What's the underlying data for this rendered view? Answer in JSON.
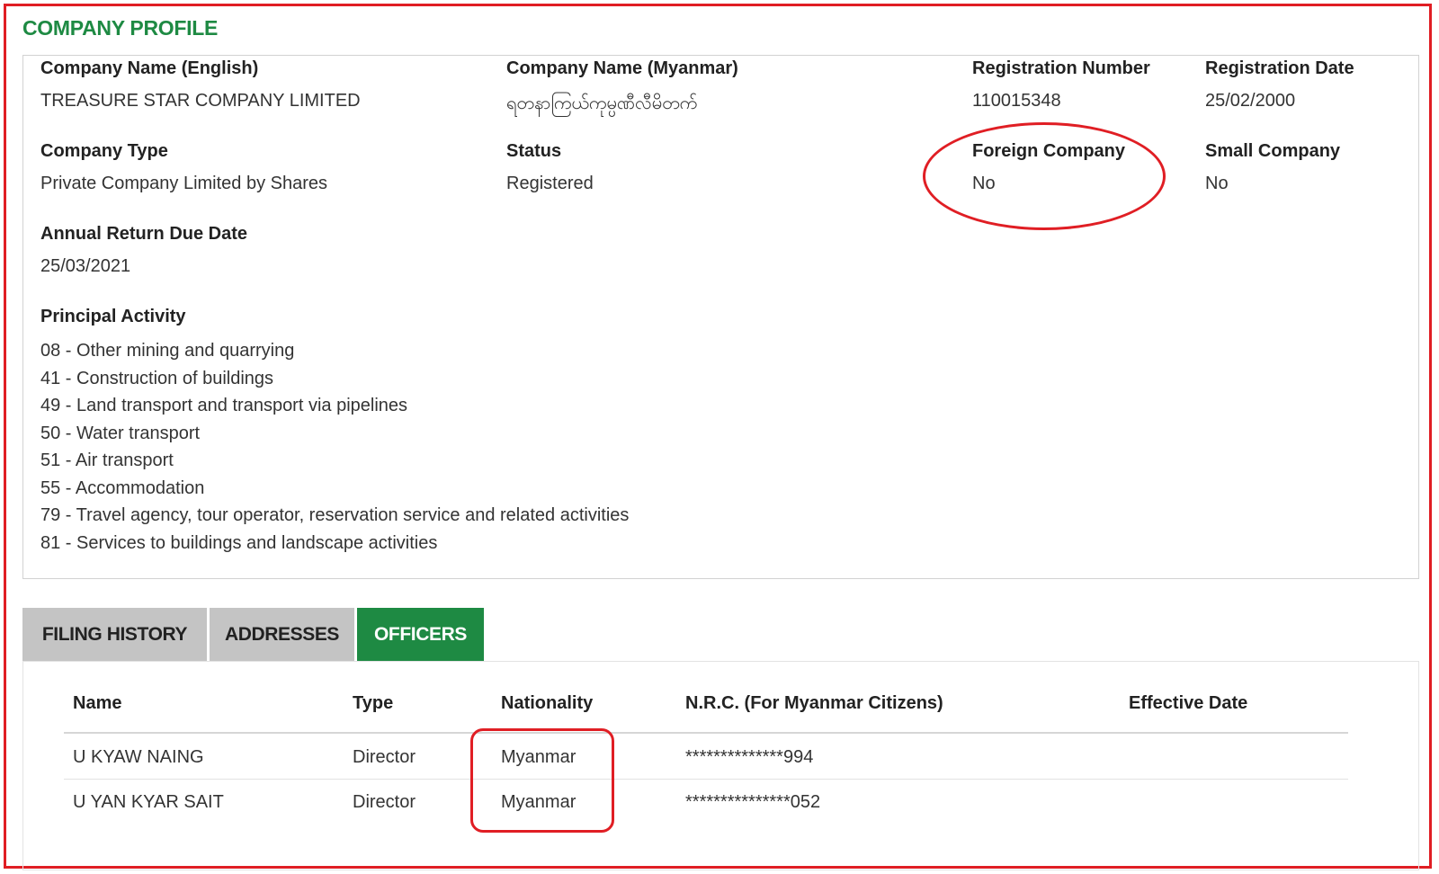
{
  "page": {
    "title": "COMPANY PROFILE",
    "accent_color": "#1e8a43",
    "annotation_color": "#e01e24"
  },
  "profile": {
    "company_name_en": {
      "label": "Company Name (English)",
      "value": "TREASURE STAR COMPANY LIMITED"
    },
    "company_name_mm": {
      "label": "Company Name (Myanmar)",
      "value": "ရတနာကြယ်ကုမ္ပဏီလီမိတက်"
    },
    "registration_number": {
      "label": "Registration Number",
      "value": "110015348"
    },
    "registration_date": {
      "label": "Registration Date",
      "value": "25/02/2000"
    },
    "company_type": {
      "label": "Company Type",
      "value": "Private Company Limited by Shares"
    },
    "status": {
      "label": "Status",
      "value": "Registered"
    },
    "foreign_company": {
      "label": "Foreign Company",
      "value": "No"
    },
    "small_company": {
      "label": "Small Company",
      "value": "No"
    },
    "annual_return_due": {
      "label": "Annual Return Due Date",
      "value": "25/03/2021"
    },
    "principal_activity": {
      "label": "Principal Activity",
      "items": [
        "08 - Other mining and quarrying",
        "41 - Construction of buildings",
        "49 - Land transport and transport via pipelines",
        "50 - Water transport",
        "51 - Air transport",
        "55 - Accommodation",
        "79 - Travel agency, tour operator, reservation service and related activities",
        "81 - Services to buildings and landscape activities"
      ]
    }
  },
  "tabs": [
    {
      "label": "FILING HISTORY",
      "active": false
    },
    {
      "label": "ADDRESSES",
      "active": false
    },
    {
      "label": "OFFICERS",
      "active": true
    }
  ],
  "officers": {
    "columns": [
      "Name",
      "Type",
      "Nationality",
      "N.R.C. (For Myanmar Citizens)",
      "Effective Date"
    ],
    "rows": [
      {
        "name": "U KYAW NAING",
        "type": "Director",
        "nationality": "Myanmar",
        "nrc": "**************994",
        "effective_date": ""
      },
      {
        "name": "U YAN KYAR SAIT",
        "type": "Director",
        "nationality": "Myanmar",
        "nrc": "***************052",
        "effective_date": ""
      }
    ]
  }
}
